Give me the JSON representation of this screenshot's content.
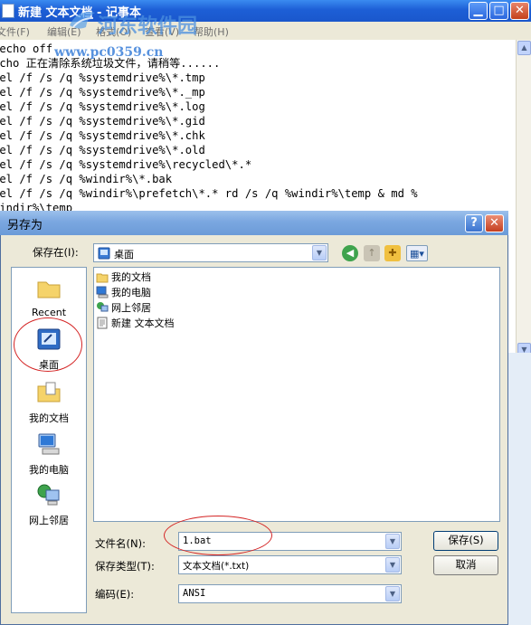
{
  "notepad": {
    "title": "新建 文本文档 - 记事本",
    "menu": [
      "文件(F)",
      "编辑(E)",
      "格式(O)",
      "查看(V)",
      "帮助(H)"
    ],
    "lines": [
      "@echo off",
      "echo 正在清除系统垃圾文件，请稍等......",
      "del /f /s /q %systemdrive%\\*.tmp",
      "del /f /s /q %systemdrive%\\*._mp",
      "del /f /s /q %systemdrive%\\*.log",
      "del /f /s /q %systemdrive%\\*.gid",
      "del /f /s /q %systemdrive%\\*.chk",
      "del /f /s /q %systemdrive%\\*.old",
      "del /f /s /q %systemdrive%\\recycled\\*.*",
      "del /f /s /q %windir%\\*.bak",
      "del /f /s /q %windir%\\prefetch\\*.* rd /s /q %windir%\\temp & md %",
      "windir%\\temp"
    ]
  },
  "watermark": {
    "site_name": "河东软件园",
    "url": "www.pc0359.cn"
  },
  "dialog": {
    "title": "另存为",
    "save_in_label": "保存在(I):",
    "save_in_value": "桌面",
    "places": [
      "Recent",
      "桌面",
      "我的文档",
      "我的电脑",
      "网上邻居"
    ],
    "files": [
      "我的文档",
      "我的电脑",
      "网上邻居",
      "新建 文本文档"
    ],
    "filename_label": "文件名(N):",
    "filename_value": "1.bat",
    "filetype_label": "保存类型(T):",
    "filetype_value": "文本文档(*.txt)",
    "encoding_label": "编码(E):",
    "encoding_value": "ANSI",
    "save_button": "保存(S)",
    "cancel_button": "取消"
  },
  "colors": {
    "notepad_titlebar": "#1d5fd6",
    "dialog_titlebar": "#7aa7e0",
    "dialog_bg": "#ece9d8",
    "highlight_ellipse": "#d42424"
  }
}
